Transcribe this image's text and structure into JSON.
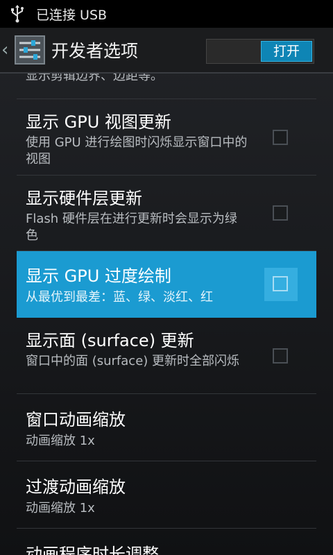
{
  "status_bar": {
    "usb_label": "已连接 USB"
  },
  "action_bar": {
    "title": "开发者选项",
    "toggle_label": "打开"
  },
  "items": [
    {
      "summary": "显示剪辑边界、边距等。"
    },
    {
      "title": "显示 GPU 视图更新",
      "summary": "使用 GPU 进行绘图时闪烁显示窗口中的视图",
      "checked": false
    },
    {
      "title": "显示硬件层更新",
      "summary": "Flash 硬件层在进行更新时会显示为绿色",
      "checked": false
    },
    {
      "title": "显示 GPU 过度绘制",
      "summary": "从最优到最差：蓝、绿、淡红、红",
      "checked": false,
      "selected": true
    },
    {
      "title": "显示面 (surface) 更新",
      "summary": "窗口中的面 (surface) 更新时全部闪烁",
      "checked": false
    },
    {
      "title": "窗口动画缩放",
      "summary": "动画缩放 1x"
    },
    {
      "title": "过渡动画缩放",
      "summary": "动画缩放 1x"
    },
    {
      "title": "动画程序时长调整"
    }
  ],
  "colors": {
    "accent": "#33b5e5",
    "selected_row": "#1b9bd1"
  }
}
